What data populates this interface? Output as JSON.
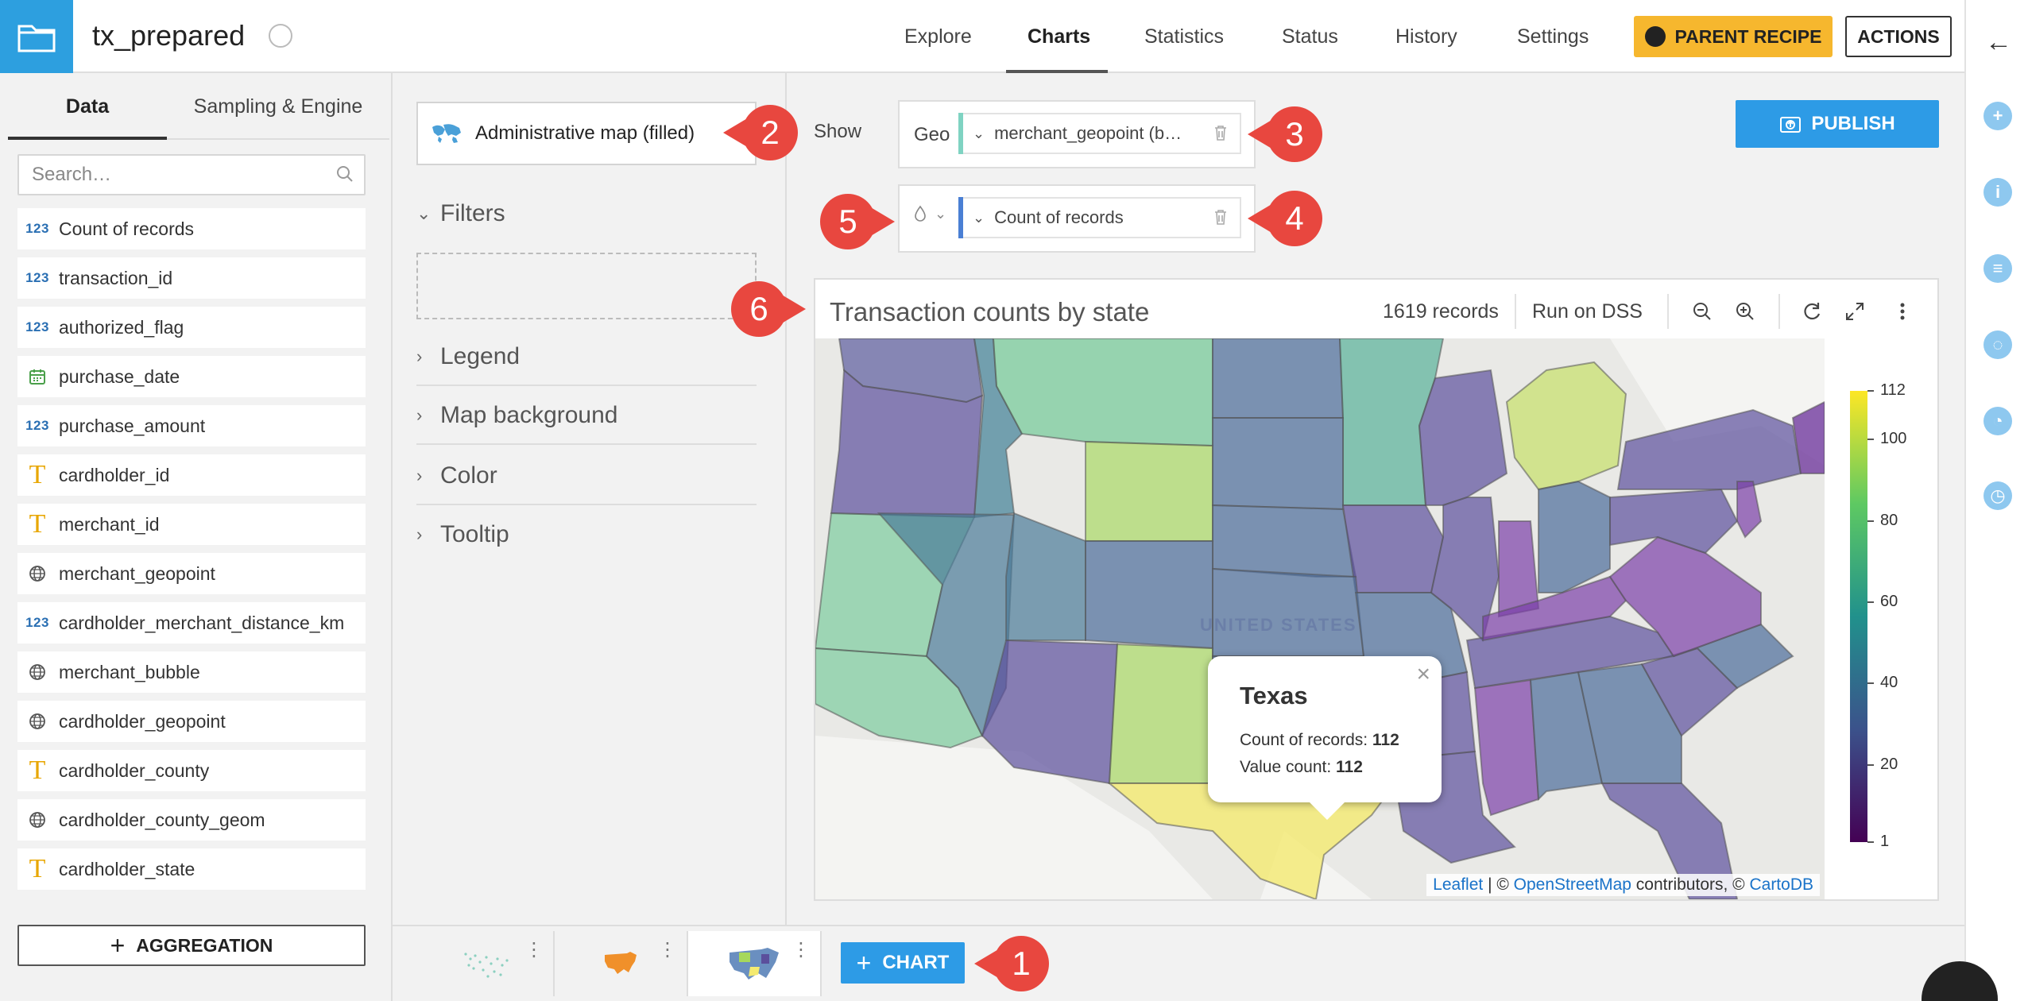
{
  "header": {
    "title": "tx_prepared",
    "nav": [
      "Explore",
      "Charts",
      "Statistics",
      "Status",
      "History",
      "Settings"
    ],
    "active_nav": "Charts",
    "parent_recipe": "PARENT RECIPE",
    "actions": "ACTIONS"
  },
  "left_panel": {
    "tabs": [
      "Data",
      "Sampling & Engine"
    ],
    "search_placeholder": "Search…",
    "columns": [
      {
        "type": "123",
        "name": "Count of records"
      },
      {
        "type": "123",
        "name": "transaction_id"
      },
      {
        "type": "123",
        "name": "authorized_flag"
      },
      {
        "type": "date",
        "name": "purchase_date"
      },
      {
        "type": "123",
        "name": "purchase_amount"
      },
      {
        "type": "text",
        "name": "cardholder_id"
      },
      {
        "type": "text",
        "name": "merchant_id"
      },
      {
        "type": "geo",
        "name": "merchant_geopoint"
      },
      {
        "type": "123",
        "name": "cardholder_merchant_distance_km"
      },
      {
        "type": "geo",
        "name": "merchant_bubble"
      },
      {
        "type": "geo",
        "name": "cardholder_geopoint"
      },
      {
        "type": "text",
        "name": "cardholder_county"
      },
      {
        "type": "geo",
        "name": "cardholder_county_geom"
      },
      {
        "type": "text",
        "name": "cardholder_state"
      }
    ],
    "aggregation_button": "AGGREGATION"
  },
  "config": {
    "chart_type": "Administrative map (filled)",
    "sections": [
      "Filters",
      "Legend",
      "Map background",
      "Color",
      "Tooltip"
    ],
    "show_label": "Show",
    "geo_label": "Geo",
    "geo_value": "merchant_geopoint (b…",
    "measure_value": "Count of records",
    "publish": "PUBLISH"
  },
  "chart": {
    "title": "Transaction counts by state",
    "records": "1619 records",
    "run_on": "Run on DSS",
    "country_label": "UNITED STATES",
    "tooltip": {
      "title": "Texas",
      "rows": [
        {
          "label": "Count of records: ",
          "value": "112"
        },
        {
          "label": "Value count: ",
          "value": "112"
        }
      ]
    },
    "legend_labels": [
      "112",
      "100",
      "80",
      "60",
      "40",
      "20",
      "1"
    ],
    "attribution": {
      "leaflet": "Leaflet",
      "sep1": " | © ",
      "osm": "OpenStreetMap",
      "contrib": " contributors, © ",
      "carto": "CartoDB"
    }
  },
  "chart_data": {
    "type": "heatmap",
    "title": "Transaction counts by state",
    "legend_range": [
      1,
      112
    ],
    "legend_ticks": [
      112,
      100,
      80,
      60,
      40,
      20,
      1
    ],
    "highlighted": {
      "state": "Texas",
      "count_of_records": 112,
      "value_count": 112
    },
    "colormap": "viridis"
  },
  "bottom": {
    "add_chart": "CHART"
  },
  "callouts": [
    "1",
    "2",
    "3",
    "4",
    "5",
    "6"
  ]
}
